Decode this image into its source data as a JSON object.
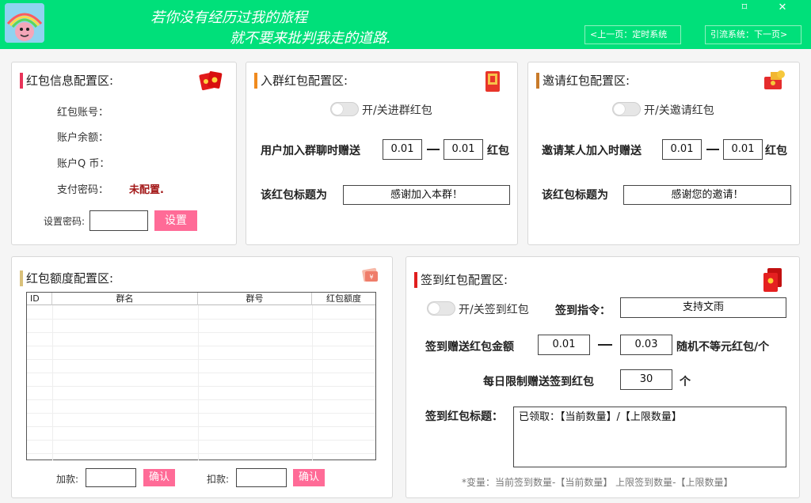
{
  "header": {
    "slogan_line1": "若你没有经历过我的旅程",
    "slogan_line2": "就不要来批判我走的道路.",
    "restore_icon": "⌑",
    "close_icon": "✕",
    "nav_prev": "<上一页：定时系统",
    "nav_next": "引流系统：下一页>"
  },
  "info_panel": {
    "title": "红包信息配置区:",
    "account_label": "红包账号：",
    "balance_label": "账户余额：",
    "qcoin_label": "账户Q 币：",
    "paypwd_label": "支付密码：",
    "paypwd_status": "未配置.",
    "setpwd_label": "设置密码:",
    "setpwd_value": "",
    "set_button": "设置"
  },
  "join_panel": {
    "title": "入群红包配置区:",
    "toggle_label": "开/关进群红包",
    "gift_label": "用户加入群聊时赠送",
    "min": "0.01",
    "max": "0.01",
    "dash": "—",
    "unit": "红包",
    "title_label": "该红包标题为",
    "title_value": "感谢加入本群！"
  },
  "invite_panel": {
    "title": "邀请红包配置区:",
    "toggle_label": "开/关邀请红包",
    "gift_label": "邀请某人加入时赠送",
    "min": "0.01",
    "max": "0.01",
    "dash": "—",
    "unit": "红包",
    "title_label": "该红包标题为",
    "title_value": "感谢您的邀请！"
  },
  "quota_panel": {
    "title": "红包额度配置区:",
    "columns": [
      "ID",
      "群名",
      "群号",
      "红包额度"
    ],
    "add_label": "加款:",
    "add_value": "",
    "add_button": "确认",
    "deduct_label": "扣款:",
    "deduct_value": "",
    "deduct_button": "确认"
  },
  "signin_panel": {
    "title": "签到红包配置区:",
    "toggle_label": "开/关签到红包",
    "cmd_label": "签到指令：",
    "cmd_value": "支持文雨",
    "gift_label": "签到赠送红包金额",
    "min": "0.01",
    "max": "0.03",
    "dash": "—",
    "unit": "随机不等元红包/个",
    "limit_label": "每日限制赠送签到红包",
    "limit_value": "30",
    "limit_unit": "个",
    "title_label": "签到红包标题：",
    "title_value": "已领取：【当前数量】/【上限数量】",
    "hint": "*变量：当前签到数量-【当前数量】 上限签到数量-【上限数量】"
  },
  "colors": {
    "header_bg": "#00e07a",
    "accent_pink": "#ff6b97",
    "bar_red": "#e8345a",
    "bar_orange": "#f08a1e",
    "bar_brown": "#c87a2a",
    "bar_tan": "#d9c07a",
    "bar_scarlet": "#e01e1e",
    "status_red": "#a31818"
  }
}
